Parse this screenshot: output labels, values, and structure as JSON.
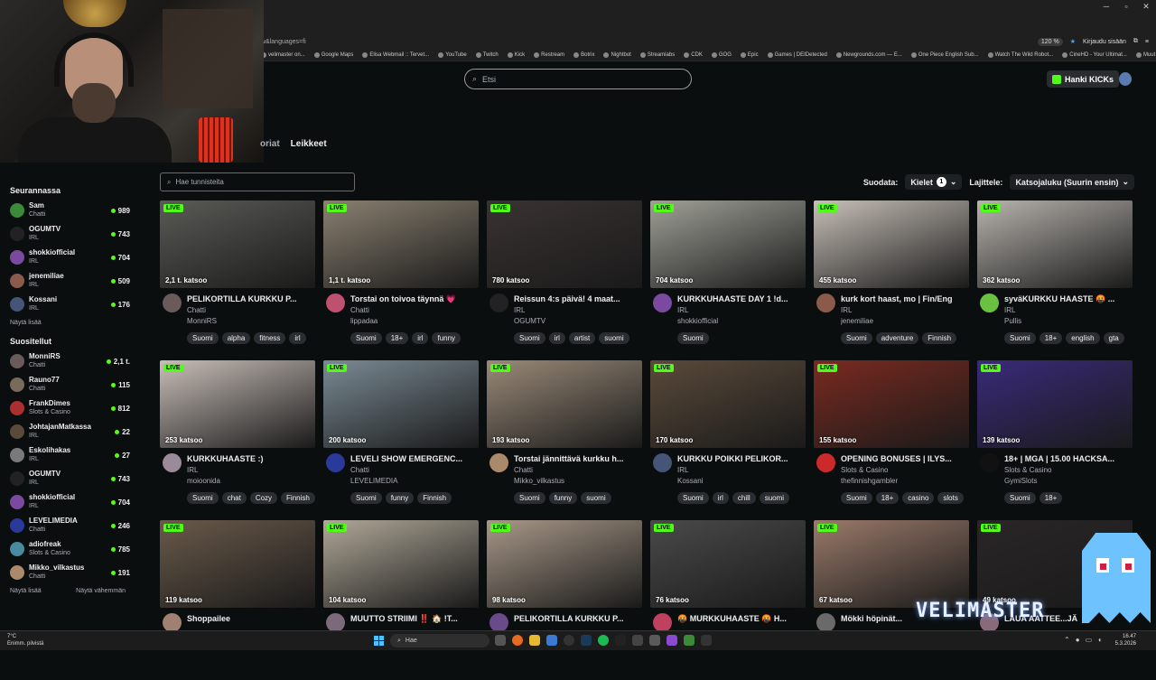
{
  "browser": {
    "url": "w&languages=fi",
    "zoom": "120 %",
    "login_label": "Kirjaudu sisään",
    "bookmarks": [
      "velimaster on...",
      "Google Maps",
      "Elisa Webmail :: Tervet...",
      "YouTube",
      "Twitch",
      "Kick",
      "Restream",
      "Botrix",
      "Nightbot",
      "Streamlabs",
      "CDK",
      "GOG",
      "Epic",
      "Games | DEIDetected",
      "Newgrounds.com — E...",
      "One Piece English Sub...",
      "Watch The Wild Robot...",
      "CineHD - Your Ultimat...",
      "Muut kirjanmerkit"
    ]
  },
  "header": {
    "search_placeholder": "Etsi",
    "kicks_button": "Hanki KICKs"
  },
  "tabs": [
    "oriat",
    "Leikkeet"
  ],
  "filters": {
    "tag_placeholder": "Hae tunnisteita",
    "filter_label": "Suodata:",
    "languages_label": "Kielet",
    "languages_count": "1",
    "sort_label": "Lajittele:",
    "sort_value": "Katsojaluku (Suurin ensin)"
  },
  "sidebar": {
    "following_title": "Seurannassa",
    "following": [
      {
        "name": "Sam",
        "category": "Chatti",
        "viewers": "989",
        "color": "#3a8a3a"
      },
      {
        "name": "OGUMTV",
        "category": "IRL",
        "viewers": "743",
        "color": "#222"
      },
      {
        "name": "shokkiofficial",
        "category": "IRL",
        "viewers": "704",
        "color": "#7a4aa0"
      },
      {
        "name": "jenemiliae",
        "category": "IRL",
        "viewers": "509",
        "color": "#8a5a4a"
      },
      {
        "name": "Kossani",
        "category": "IRL",
        "viewers": "176",
        "color": "#445577"
      }
    ],
    "show_more": "Näytä lisää",
    "recommended_title": "Suositellut",
    "recommended": [
      {
        "name": "MonniRS",
        "category": "Chatti",
        "viewers": "2,1 t.",
        "color": "#6a5a5a"
      },
      {
        "name": "Rauno77",
        "category": "Chatti",
        "viewers": "115",
        "color": "#7a6a5a"
      },
      {
        "name": "FrankDimes",
        "category": "Slots & Casino",
        "viewers": "812",
        "color": "#aa3030"
      },
      {
        "name": "JohtajanMatkassa",
        "category": "IRL",
        "viewers": "22",
        "color": "#5a4a3a"
      },
      {
        "name": "Eskolihakas",
        "category": "IRL",
        "viewers": "27",
        "color": "#7a7a7a"
      },
      {
        "name": "OGUMTV",
        "category": "IRL",
        "viewers": "743",
        "color": "#222"
      },
      {
        "name": "shokkiofficial",
        "category": "IRL",
        "viewers": "704",
        "color": "#7a4aa0"
      },
      {
        "name": "LEVELIMEDIA",
        "category": "Chatti",
        "viewers": "246",
        "color": "#2a3a9a"
      },
      {
        "name": "adiofreak",
        "category": "Slots & Casino",
        "viewers": "785",
        "color": "#4a8aa0"
      },
      {
        "name": "Mikko_vilkastus",
        "category": "Chatti",
        "viewers": "191",
        "color": "#aa8a6a"
      }
    ],
    "show_more2": "Näytä lisää",
    "show_less": "Näytä vähemmän"
  },
  "streams": [
    {
      "live": "LIVE",
      "viewers": "2,1 t. katsoo",
      "title": "PELIKORTILLA KURKKU P...",
      "category": "Chatti",
      "channel": "MonniRS",
      "tags": [
        "Suomi",
        "alpha",
        "fitness",
        "irl"
      ],
      "thumb": "#5a5a56",
      "avatar": "#6a5a5a"
    },
    {
      "live": "LIVE",
      "viewers": "1,1 t. katsoo",
      "title": "Torstai on toivoa täynnä 💗",
      "category": "Chatti",
      "channel": "lippadaa",
      "tags": [
        "Suomi",
        "18+",
        "irl",
        "funny"
      ],
      "thumb": "#8a8070",
      "avatar": "#c05070"
    },
    {
      "live": "LIVE",
      "viewers": "780 katsoo",
      "title": "Reissun 4:s päivä! 4 maat...",
      "category": "IRL",
      "channel": "OGUMTV",
      "tags": [
        "Suomi",
        "irl",
        "artist",
        "suomi"
      ],
      "thumb": "#3a3232",
      "avatar": "#222"
    },
    {
      "live": "LIVE",
      "viewers": "704 katsoo",
      "title": "KURKKUHAASTE DAY 1 !d...",
      "category": "IRL",
      "channel": "shokkiofficial",
      "tags": [
        "Suomi"
      ],
      "thumb": "#a0a098",
      "avatar": "#7a4aa0"
    },
    {
      "live": "LIVE",
      "viewers": "455 katsoo",
      "title": "kurk kort haast, mo | Fin/Eng",
      "category": "IRL",
      "channel": "jenemiliae",
      "tags": [
        "Suomi",
        "adventure",
        "Finnish"
      ],
      "thumb": "#c8c0b8",
      "avatar": "#8a5a4a"
    },
    {
      "live": "LIVE",
      "viewers": "362 katsoo",
      "title": "syväKURKKU HAASTE 🤬 ...",
      "category": "IRL",
      "channel": "Pullis",
      "tags": [
        "Suomi",
        "18+",
        "english",
        "gta"
      ],
      "thumb": "#b8b4ae",
      "avatar": "#6ac040"
    },
    {
      "live": "LIVE",
      "viewers": "253 katsoo",
      "title": "KURKKUHAASTE :)",
      "category": "IRL",
      "channel": "moioonida",
      "tags": [
        "Suomi",
        "chat",
        "Cozy",
        "Finnish"
      ],
      "thumb": "#c8beb8",
      "avatar": "#9a8a9a"
    },
    {
      "live": "LIVE",
      "viewers": "200 katsoo",
      "title": "LEVELI SHOW EMERGENC...",
      "category": "Chatti",
      "channel": "LEVELIMEDIA",
      "tags": [
        "Suomi",
        "funny",
        "Finnish"
      ],
      "thumb": "#7a8a94",
      "avatar": "#2a3a9a"
    },
    {
      "live": "LIVE",
      "viewers": "193 katsoo",
      "title": "Torstai jännittävä kurkku h...",
      "category": "Chatti",
      "channel": "Mikko_vilkastus",
      "tags": [
        "Suomi",
        "funny",
        "suomi"
      ],
      "thumb": "#9a8a78",
      "avatar": "#aa8a6a"
    },
    {
      "live": "LIVE",
      "viewers": "170 katsoo",
      "title": "KURKKU POIKKI PELIKOR...",
      "category": "IRL",
      "channel": "Kossani",
      "tags": [
        "Suomi",
        "irl",
        "chill",
        "suomi"
      ],
      "thumb": "#5a4a3a",
      "avatar": "#445577"
    },
    {
      "live": "LIVE",
      "viewers": "155 katsoo",
      "title": "OPENING BONUSES | ILYS...",
      "category": "Slots & Casino",
      "channel": "thefinnishgambler",
      "tags": [
        "Suomi",
        "18+",
        "casino",
        "slots"
      ],
      "thumb": "#7a2a20",
      "avatar": "#cc2a2a"
    },
    {
      "live": "LIVE",
      "viewers": "139 katsoo",
      "title": "18+ | MGA | 15.00 HACKSA...",
      "category": "Slots & Casino",
      "channel": "GymiSlots",
      "tags": [
        "Suomi",
        "18+"
      ],
      "thumb": "#3a2a7a",
      "avatar": "#111"
    },
    {
      "live": "LIVE",
      "viewers": "119 katsoo",
      "title": "Shoppailee",
      "category": "",
      "channel": "",
      "tags": [],
      "thumb": "#6a5a4a",
      "avatar": "#a08070"
    },
    {
      "live": "LIVE",
      "viewers": "104 katsoo",
      "title": "MUUTTO STRIIMI ‼️ 🏠 !T...",
      "category": "",
      "channel": "",
      "tags": [],
      "thumb": "#b0a898",
      "avatar": "#7a6a7a"
    },
    {
      "live": "LIVE",
      "viewers": "98 katsoo",
      "title": "PELIKORTILLA KURKKU P...",
      "category": "",
      "channel": "",
      "tags": [],
      "thumb": "#a89888",
      "avatar": "#6a4a8a"
    },
    {
      "live": "LIVE",
      "viewers": "76 katsoo",
      "title": "🤬 MURKKUHAASTE 🤬 H...",
      "category": "",
      "channel": "",
      "tags": [],
      "thumb": "#4a4a4a",
      "avatar": "#c04060"
    },
    {
      "live": "LIVE",
      "viewers": "67 katsoo",
      "title": "Mökki höpinät...",
      "category": "",
      "channel": "",
      "tags": [],
      "thumb": "#9a7a6a",
      "avatar": "#6a6a6a"
    },
    {
      "live": "LIVE",
      "viewers": "49 katsoo",
      "title": "LAUA AATTEE...JÄ",
      "category": "",
      "channel": "",
      "tags": [],
      "thumb": "#2a2628",
      "avatar": "#8a6a7a"
    }
  ],
  "overlay": {
    "watermark": "VELIMASTER"
  },
  "taskbar": {
    "weather_temp": "7°C",
    "weather_desc": "Enimm. pilvistä",
    "search": "Hae",
    "time": "16.47",
    "date": "5.3.2026"
  }
}
